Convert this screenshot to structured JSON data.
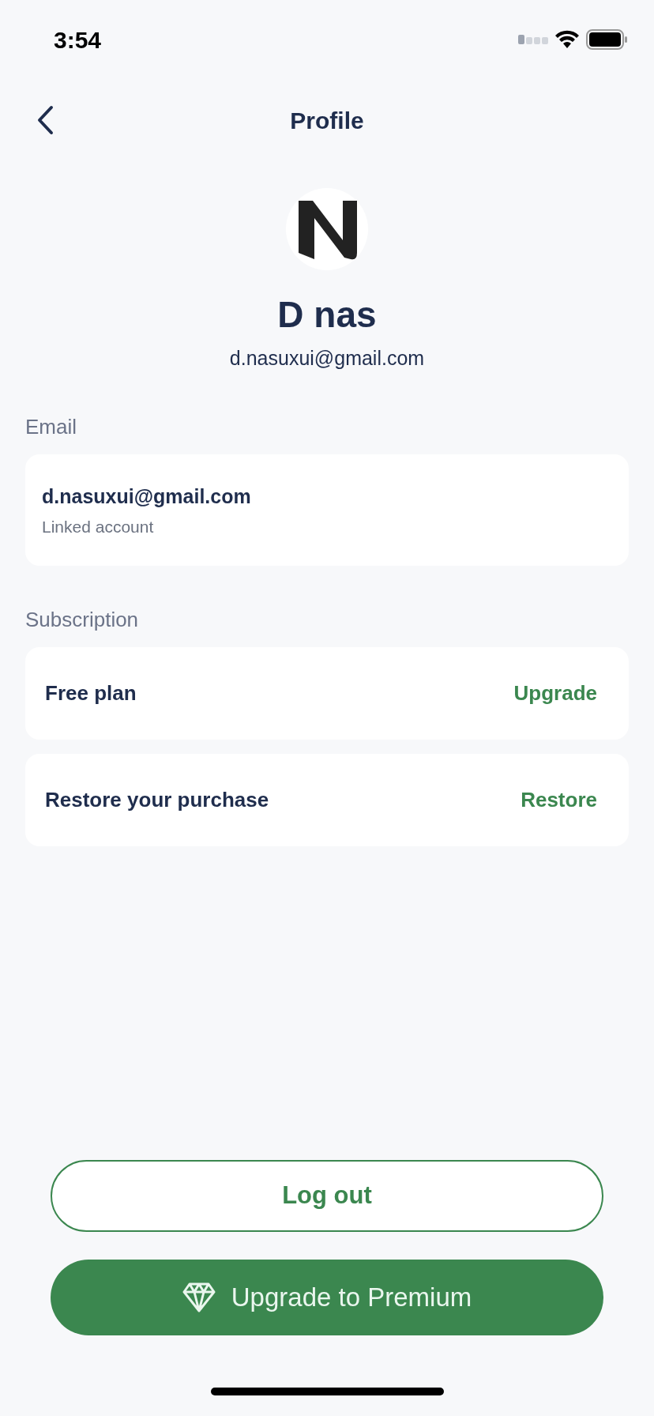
{
  "status_bar": {
    "time": "3:54"
  },
  "nav": {
    "title": "Profile"
  },
  "profile": {
    "name": "D nas",
    "email": "d.nasuxui@gmail.com"
  },
  "email_section": {
    "label": "Email",
    "value": "d.nasuxui@gmail.com",
    "caption": "Linked account"
  },
  "subscription_section": {
    "label": "Subscription",
    "rows": [
      {
        "text": "Free plan",
        "action": "Upgrade"
      },
      {
        "text": "Restore your purchase",
        "action": "Restore"
      }
    ]
  },
  "buttons": [
    {
      "kind": "outline",
      "label": "Log out"
    },
    {
      "kind": "filled",
      "label": "Upgrade to Premium"
    }
  ]
}
